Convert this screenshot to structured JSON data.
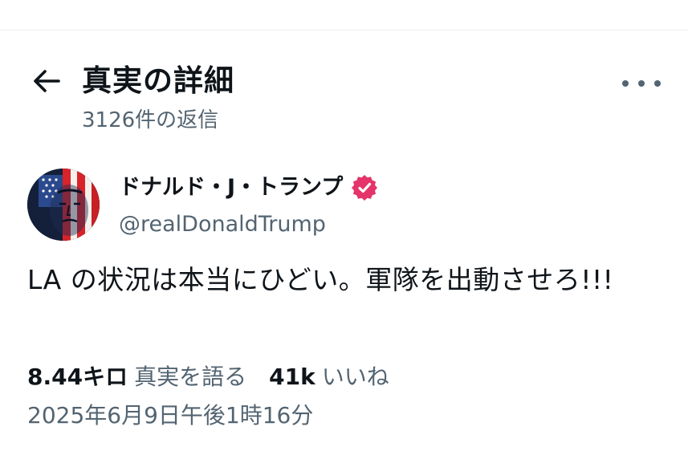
{
  "header": {
    "title": "真実の詳細",
    "reply_count": "3126件の返信",
    "back_icon": "arrow-left-icon",
    "more_icon": "ellipsis-horizontal-icon"
  },
  "post": {
    "author": {
      "name": "ドナルド・J・トランプ",
      "handle": "@realDonaldTrump",
      "verified_icon": "verified-badge-icon",
      "verified_color": "#e5336b"
    },
    "text": "LA の状況は本当にひどい。軍隊を出動させろ!!!",
    "stats": {
      "retruths_count": "8.44キロ",
      "retruths_label": "真実を語る",
      "likes_count": "41k",
      "likes_label": "いいね"
    },
    "timestamp": "2025年6月9日午後1時16分"
  },
  "colors": {
    "text_primary": "#0f1419",
    "text_secondary": "#536471",
    "divider": "#eceef0"
  }
}
